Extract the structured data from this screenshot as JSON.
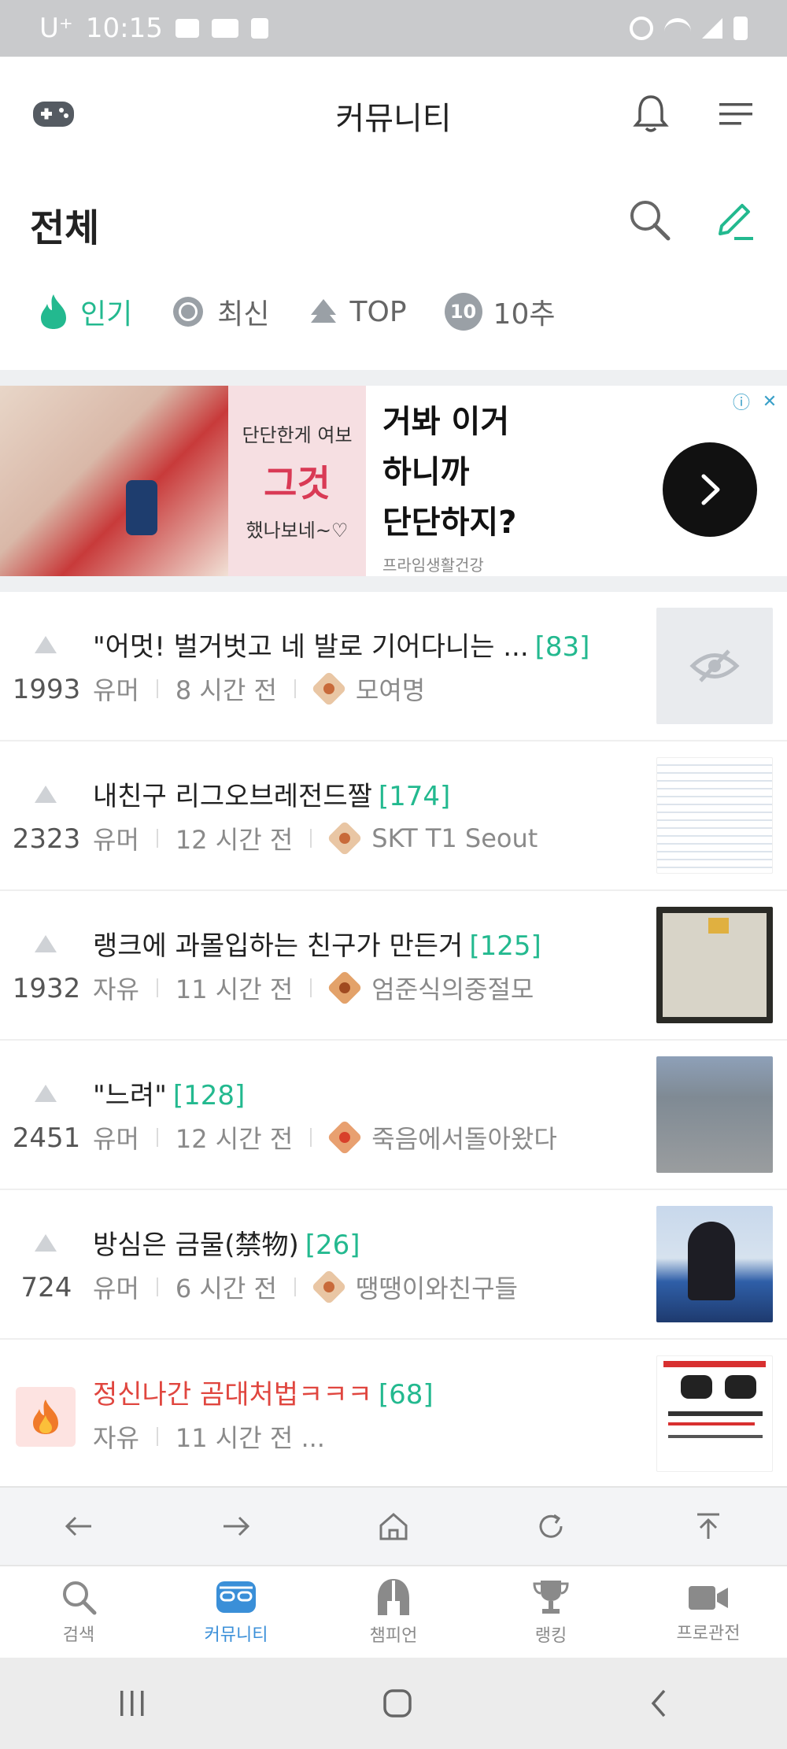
{
  "status_bar": {
    "carrier": "U⁺",
    "time": "10:15"
  },
  "header": {
    "title": "커뮤니티"
  },
  "section": {
    "title": "전체"
  },
  "tabs": [
    {
      "label": "인기",
      "icon": "flame-icon",
      "active": true
    },
    {
      "label": "최신",
      "icon": "gear-icon",
      "active": false
    },
    {
      "label": "TOP",
      "icon": "top-arrow-icon",
      "active": false
    },
    {
      "label": "10추",
      "icon": "ten-badge-icon",
      "badge": "10",
      "active": false
    }
  ],
  "ad": {
    "pink_line1": "단단한게 여보",
    "pink_line2": "그것",
    "pink_line3": "했나보네~♡",
    "headline": [
      "거봐 이거",
      "하니까",
      "단단하지?"
    ],
    "source": "프라임생활건강"
  },
  "posts": [
    {
      "votes": "1993",
      "title": "\"어멋! 벌거벗고 네 발로 기어다니는 ...",
      "comments": "[83]",
      "board": "유머",
      "time": "8 시간 전",
      "author": "모여명",
      "thumb": "hidden-icon"
    },
    {
      "votes": "2323",
      "title": "내친구 리그오브레전드짤",
      "comments": "[174]",
      "board": "유머",
      "time": "12 시간 전",
      "author": "SKT T1 Seout",
      "thumb": "table"
    },
    {
      "votes": "1932",
      "title": "랭크에 과몰입하는 친구가 만든거",
      "comments": "[125]",
      "board": "자유",
      "time": "11 시간 전",
      "author": "엄준식의중절모",
      "thumb": "paper"
    },
    {
      "votes": "2451",
      "title": "\"느려\"",
      "comments": "[128]",
      "board": "유머",
      "time": "12 시간 전",
      "author": "죽음에서돌아왔다",
      "thumb": "street"
    },
    {
      "votes": "724",
      "title": "방심은 금물(禁物)",
      "comments": "[26]",
      "board": "유머",
      "time": "6 시간 전",
      "author": "땡땡이와친구들",
      "thumb": "stadium"
    },
    {
      "votes": "",
      "title": "정신나간 곰대처법ㅋㅋㅋ",
      "comments": "[68]",
      "board": "자유",
      "time": "11 시간 전 ...",
      "author": "",
      "thumb": "bear",
      "hot": true
    }
  ],
  "bottom_nav": [
    {
      "label": "검색",
      "icon": "search-icon",
      "active": false
    },
    {
      "label": "커뮤니티",
      "icon": "community-icon",
      "active": true
    },
    {
      "label": "챔피언",
      "icon": "helmet-icon",
      "active": false
    },
    {
      "label": "랭킹",
      "icon": "trophy-icon",
      "active": false
    },
    {
      "label": "프로관전",
      "icon": "video-camera-icon",
      "active": false
    }
  ],
  "colors": {
    "accent": "#23b98f",
    "nav_active": "#3a8fd8",
    "hot_title": "#e0463f"
  }
}
